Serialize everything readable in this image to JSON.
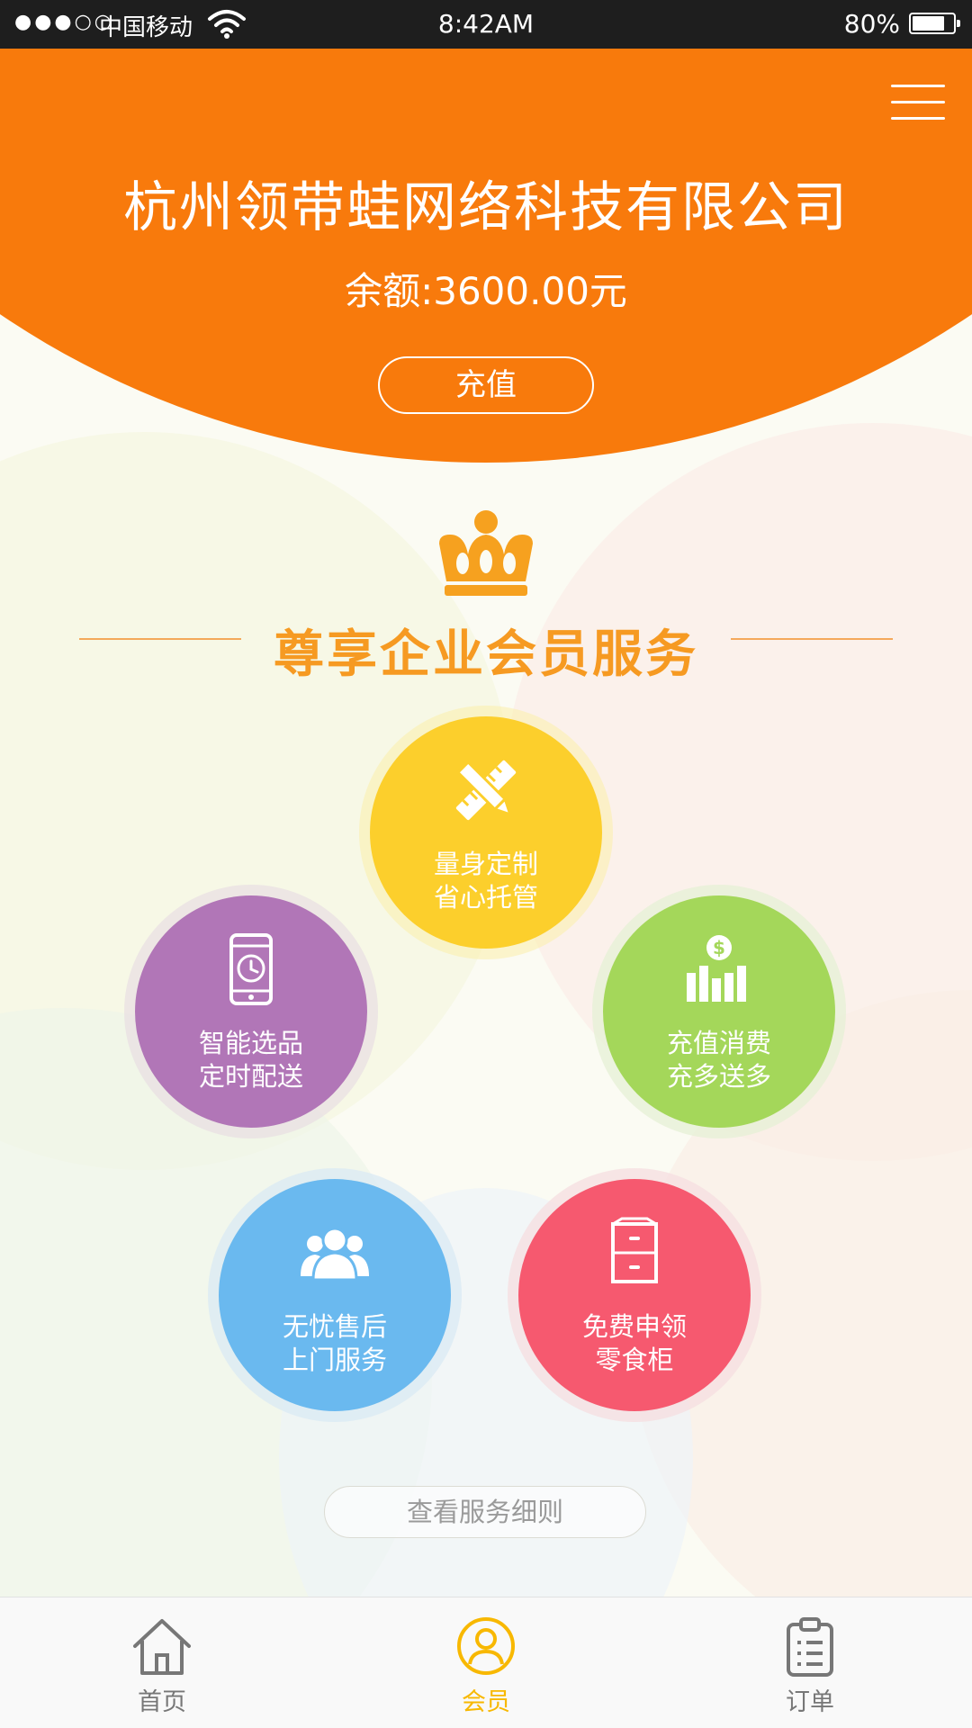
{
  "status_bar": {
    "signal": "●●●○○",
    "carrier": "中国移动",
    "time": "8:42AM",
    "battery_text": "80%",
    "battery_level": 0.8
  },
  "header": {
    "company_name": "杭州领带蛙网络科技有限公司",
    "balance": "余额:3600.00元",
    "recharge_label": "充值"
  },
  "section": {
    "title": "尊享企业会员服务"
  },
  "services": [
    {
      "line1": "量身定制",
      "line2": "省心托管",
      "icon": "pencil-ruler-icon",
      "color": "#fccf2c"
    },
    {
      "line1": "智能选品",
      "line2": "定时配送",
      "icon": "phone-clock-icon",
      "color": "#b176b7"
    },
    {
      "line1": "充值消费",
      "line2": "充多送多",
      "icon": "money-chart-icon",
      "color": "#a4d75a"
    },
    {
      "line1": "无忧售后",
      "line2": "上门服务",
      "icon": "users-icon",
      "color": "#6ab9ef"
    },
    {
      "line1": "免费申领",
      "line2": "零食柜",
      "icon": "cabinet-icon",
      "color": "#f6596f"
    }
  ],
  "rules_label": "查看服务细则",
  "tabs": [
    {
      "label": "首页",
      "icon": "home-icon",
      "active": false
    },
    {
      "label": "会员",
      "icon": "member-icon",
      "active": true
    },
    {
      "label": "订单",
      "icon": "order-clipboard-icon",
      "active": false
    }
  ],
  "colors": {
    "brand_orange": "#f87a0c",
    "title_orange": "#f69a22",
    "tab_active": "#f8b800",
    "tab_inactive": "#777777"
  }
}
